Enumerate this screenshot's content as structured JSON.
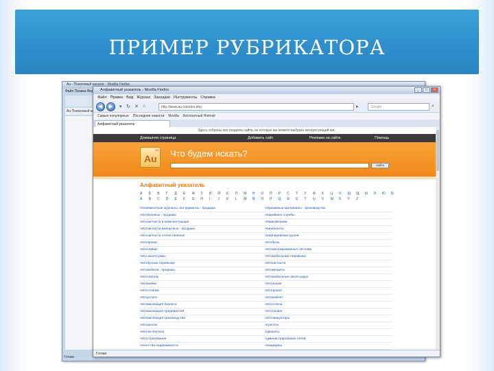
{
  "slide": {
    "title": "ПРИМЕР РУБРИКАТОРА"
  },
  "back_window": {
    "title": "Au - Поисковый каталог - Mozilla Firefox",
    "menu": "Файл  Правка  Вид  Журнал  Закладки  Инструменты  Справка",
    "tab": "Au Поисковый каталог",
    "status": "Готово"
  },
  "browser": {
    "title": "Алфавитный указатель - Mozilla Firefox",
    "controls": [
      "_",
      "□",
      "×"
    ],
    "menu": [
      "Файл",
      "Правка",
      "Вид",
      "Журнал",
      "Закладки",
      "Инструменты",
      "Справка"
    ],
    "url": "http://www.au.ru/index.php",
    "search_placeholder": "Google",
    "bookmarks": [
      "Самые популярные",
      "Последние новости",
      "Mozilla",
      "Бесплатный Hotmail"
    ],
    "tab": "Алфавитный указатель",
    "status": "Готово",
    "page": {
      "notice": "Здесь собраны все разделы сайта, из которых вы можете выбрать интересующий вас",
      "nav": [
        "Домашняя страница",
        "Добавить сайт",
        "Реклама на сайте",
        "Помощь"
      ],
      "logo_text": "Au",
      "logo_sup": "ru",
      "question": "Что будем искать?",
      "search_button": "найти",
      "section_title": "Алфавитный указатель",
      "alphabet_row1": [
        "А",
        "Б",
        "В",
        "Г",
        "Д",
        "Е",
        "Ж",
        "З",
        "И",
        "Й",
        "К",
        "Л",
        "М",
        "Н",
        "О",
        "П",
        "Р",
        "С",
        "Т",
        "У",
        "Ф",
        "Х",
        "Ц",
        "Ч",
        "Ш",
        "Щ",
        "Ы",
        "Э",
        "Ю",
        "Я"
      ],
      "alphabet_row2": [
        "A",
        "B",
        "C",
        "D",
        "E",
        "F",
        "G",
        "H",
        "I",
        "J",
        "K",
        "L",
        "M",
        "N",
        "O",
        "P",
        "Q",
        "R",
        "S",
        "T",
        "U",
        "V",
        "W",
        "X",
        "Y",
        "Z"
      ],
      "left_column": [
        "Абонементные журналы, инструменты - продажа",
        "Автобизнесы - продажа",
        "Автозапчасти и комплектующие",
        "Автозапчасти импортные - продажа",
        "Автозапчасти отечественные",
        "Автопрокат",
        "Автосервис",
        "Авто аксессуары",
        "Автобусные перевозки",
        "Автомобили - продажа",
        "Автосалоны",
        "Автомойки",
        "Автостоянки",
        "Автоуслуги",
        "Автоматизация бизнеса",
        "Автоматизация предприятий",
        "Автоматизация производства",
        "Автошколы",
        "Автоэкспертиза",
        "Автострахование",
        "Агентства недвижимости"
      ],
      "right_column": [
        "Абразивные материалы - производство",
        "Аварийные службы",
        "Авиакомпании",
        "Авиабилеты",
        "Авиаперевозки грузов",
        "Автобусы",
        "Автоматизированные системы",
        "Автомобильные перевозки",
        "Автозапчасти",
        "Автокредиты",
        "Автомобильные аксессуары",
        "Автолизинг",
        "Автопрокат",
        "Авторемонт",
        "Автостекла",
        "Автотюнинг",
        "Автоэвакуаторы",
        "Агрегаты",
        "Адвокаты",
        "Администрирование сетей",
        "Аквариумы"
      ]
    }
  }
}
